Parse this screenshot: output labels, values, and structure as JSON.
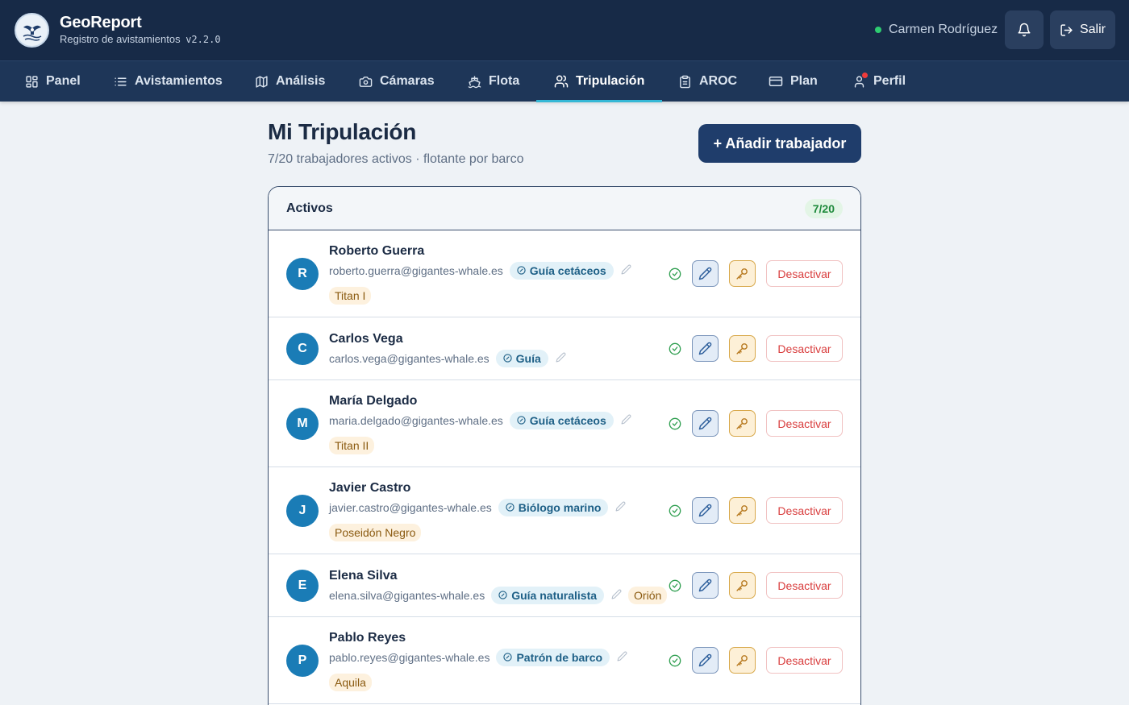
{
  "header": {
    "app_name": "GeoReport",
    "subtitle": "Registro de avistamientos",
    "version": "v2.2.0",
    "user_name": "Carmen Rodríguez",
    "logout_label": "Salir"
  },
  "nav": {
    "items": [
      {
        "label": "Panel",
        "icon": "grid-icon"
      },
      {
        "label": "Avistamientos",
        "icon": "list-icon"
      },
      {
        "label": "Análisis",
        "icon": "map-icon"
      },
      {
        "label": "Cámaras",
        "icon": "camera-icon"
      },
      {
        "label": "Flota",
        "icon": "ship-icon"
      },
      {
        "label": "Tripulación",
        "icon": "users-icon",
        "active": true
      },
      {
        "label": "AROC",
        "icon": "clipboard-icon"
      },
      {
        "label": "Plan",
        "icon": "card-icon"
      },
      {
        "label": "Perfil",
        "icon": "user-icon",
        "notification": true
      }
    ]
  },
  "page": {
    "title": "Mi Tripulación",
    "subtitle": "7/20 trabajadores activos · flotante por barco",
    "add_button": "+ Añadir trabajador"
  },
  "card": {
    "title": "Activos",
    "count": "7/20"
  },
  "workers": [
    {
      "initial": "R",
      "name": "Roberto Guerra",
      "email": "roberto.guerra@gigantes-whale.es",
      "role": "Guía cetáceos",
      "boat": "Titan I"
    },
    {
      "initial": "C",
      "name": "Carlos Vega",
      "email": "carlos.vega@gigantes-whale.es",
      "role": "Guía",
      "boat": ""
    },
    {
      "initial": "M",
      "name": "María Delgado",
      "email": "maria.delgado@gigantes-whale.es",
      "role": "Guía cetáceos",
      "boat": "Titan II"
    },
    {
      "initial": "J",
      "name": "Javier Castro",
      "email": "javier.castro@gigantes-whale.es",
      "role": "Biólogo marino",
      "boat": "Poseidón Negro"
    },
    {
      "initial": "E",
      "name": "Elena Silva",
      "email": "elena.silva@gigantes-whale.es",
      "role": "Guía naturalista",
      "boat": "Orión"
    },
    {
      "initial": "P",
      "name": "Pablo Reyes",
      "email": "pablo.reyes@gigantes-whale.es",
      "role": "Patrón de barco",
      "boat": "Aquila"
    }
  ],
  "row_actions": {
    "deactivate_label": "Desactivar"
  },
  "colors": {
    "header_bg": "#172a47",
    "nav_bg": "#1e3658",
    "accent": "#35b8d6",
    "primary_button": "#1f3d6b",
    "avatar": "#1a7cb6",
    "danger": "#d93d3d",
    "active_status": "#2ecc71"
  }
}
